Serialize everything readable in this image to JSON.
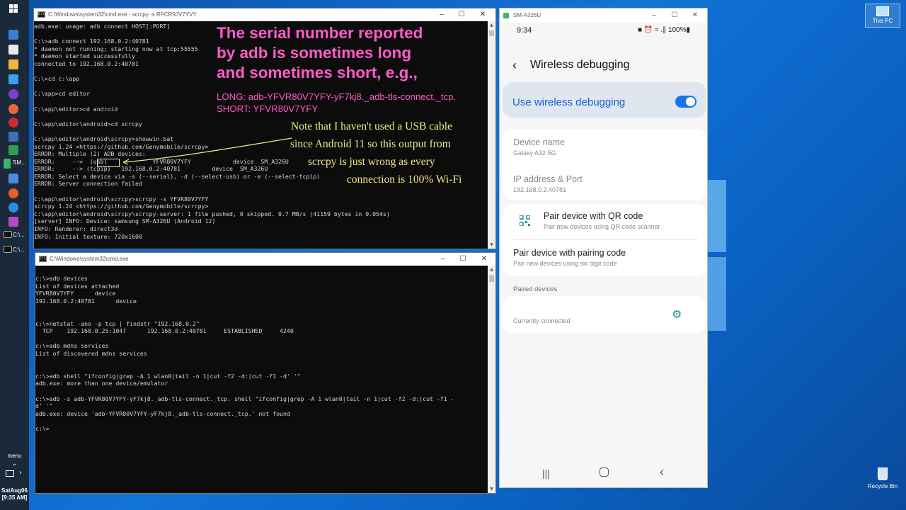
{
  "taskbar": {
    "start_icon": "windows-logo-icon",
    "items": [
      {
        "label": "",
        "icon": "app-icon"
      },
      {
        "label": "",
        "icon": "app-icon"
      },
      {
        "label": "",
        "icon": "app-icon"
      },
      {
        "label": "",
        "icon": "app-icon"
      },
      {
        "label": "",
        "icon": "app-icon"
      },
      {
        "label": "",
        "icon": "app-icon"
      },
      {
        "label": "",
        "icon": "app-icon"
      },
      {
        "label": "",
        "icon": "app-icon"
      },
      {
        "label": "",
        "icon": "app-icon"
      },
      {
        "label": "SM...",
        "icon": "phone-icon"
      },
      {
        "label": "",
        "icon": "firefox-icon"
      },
      {
        "label": "",
        "icon": "app-icon"
      },
      {
        "label": "",
        "icon": "app-icon"
      },
      {
        "label": "",
        "icon": "app-icon"
      },
      {
        "label": "C:\\...",
        "icon": "cmd-icon"
      },
      {
        "label": "C:\\...",
        "icon": "cmd-icon"
      }
    ],
    "menu_label": "menu",
    "clock_day": "SatAug06",
    "clock_time": "[9:35 AM]"
  },
  "cmd1": {
    "title": "C:\\Windows\\system32\\cmd.exe - scrcpy -s RFCR50V7YVY",
    "lines": [
      "adb.exe: usage: adb connect HOST[:PORT]",
      "",
      "C:\\>adb connect 192.168.0.2:40781",
      "* daemon not running; starting now at tcp:55555",
      "* daemon started successfully",
      "connected to 192.168.0.2:40781",
      "",
      "C:\\>cd c:\\app",
      "",
      "C:\\app>cd editor",
      "",
      "C:\\app\\editor>cd android",
      "",
      "C:\\app\\editor\\android>cd scrcpy",
      "",
      "C:\\app\\editor\\android\\scrcpy>showwin.bat",
      "scrcpy 1.24 <https://github.com/Genymobile/scrcpy>",
      "ERROR: Multiple (2) ADB devices:",
      "ERROR:     -->  (usb)             YFVR80V7YFY            device  SM_A326U",
      "ERROR:     --> (tcpip)   192.168.0.2:40781         device  SM_A326U",
      "ERROR: Select a device via -s (--serial), -d (--select-usb) or -e (--select-tcpip)",
      "ERROR: Server connection failed",
      "",
      "C:\\app\\editor\\android\\scrcpy>scrcpy -s YFVR80V7YFY",
      "scrcpy 1.24 <https://github.com/Genymobile/scrcpy>",
      "C:\\app\\editor\\android\\scrcpy\\scrcpy-server: 1 file pushed, 0 skipped. 0.7 MB/s (41159 bytes in 0.054s)",
      "[server] INFO: Device: samsung SM-A326U (Android 12)",
      "INFO: Renderer: direct3d",
      "INFO: Initial texture: 720x1600"
    ]
  },
  "cmd2": {
    "title": "C:\\Windows\\system32\\cmd.exe",
    "lines": [
      "c:\\>adb devices",
      "List of devices attached",
      "YFVR80V7YFY      device",
      "192.168.0.2:40781      device",
      "",
      "",
      "c:\\>netstat -ano -p tcp | findstr \"192.168.0.2\"",
      "  TCP    192.168.0.25:1047      192.168.0.2:40781     ESTABLISHED     4240",
      "",
      "c:\\>adb mdns services",
      "List of discovered mdns services",
      "",
      "",
      "c:\\>adb shell \"ifconfig|grep -A 1 wlan0|tail -n 1|cut -f2 -d:|cut -f1 -d' '\"",
      "adb.exe: more than one device/emulator",
      "",
      "c:\\>adb -s adb-YFVR80V7YFY-yF7kj8._adb-tls-connect._tcp. shell \"ifconfig|grep -A 1 wlan0|tail -n 1|cut -f2 -d:|cut -f1 -",
      "d' '\"",
      "adb.exe: device 'adb-YFVR80V7YFY-yF7kj8._adb-tls-connect._tcp.' not found",
      "",
      "c:\\>"
    ]
  },
  "annotation": {
    "headline": "The serial number reported\nby adb is sometimes long\nand sometimes short, e.g.,",
    "long": "LONG: adb-YFVR80V7YFY-yF7kj8._adb-tls-connect._tcp.",
    "short": "SHORT: YFVR80V7YFY",
    "note_1": "Note that I haven't used a USB cable",
    "note_2": "since Android 11 so this output from",
    "note_3": "scrcpy is just wrong as every",
    "note_4": "connection is 100% Wi-Fi",
    "color": "#ff5cc8",
    "note_color": "#f2ea86"
  },
  "phone": {
    "window_title": "SM-A326U",
    "status_time": "9:34",
    "status_icons": "■ ⏰ ≈ .∥ 100%▮",
    "page_title": "Wireless debugging",
    "toggle_label": "Use wireless debugging",
    "toggle_on": true,
    "device_name_label": "Device name",
    "device_name_value": "Galaxy A32 5G",
    "ip_label": "IP address & Port",
    "ip_value": "192.168.0.2:40781",
    "pair_qr_title": "Pair device with QR code",
    "pair_qr_sub": "Pair new devices using QR code scanner",
    "pair_code_title": "Pair device with pairing code",
    "pair_code_sub": "Pair new devices using six digit code",
    "paired_section": "Paired devices",
    "paired_device_name": "",
    "paired_device_status": "Currently connected",
    "accent": "#1a73e8"
  },
  "desktop": {
    "this_pc_label": "This PC",
    "recycle_bin_label": "Recycle Bin"
  }
}
